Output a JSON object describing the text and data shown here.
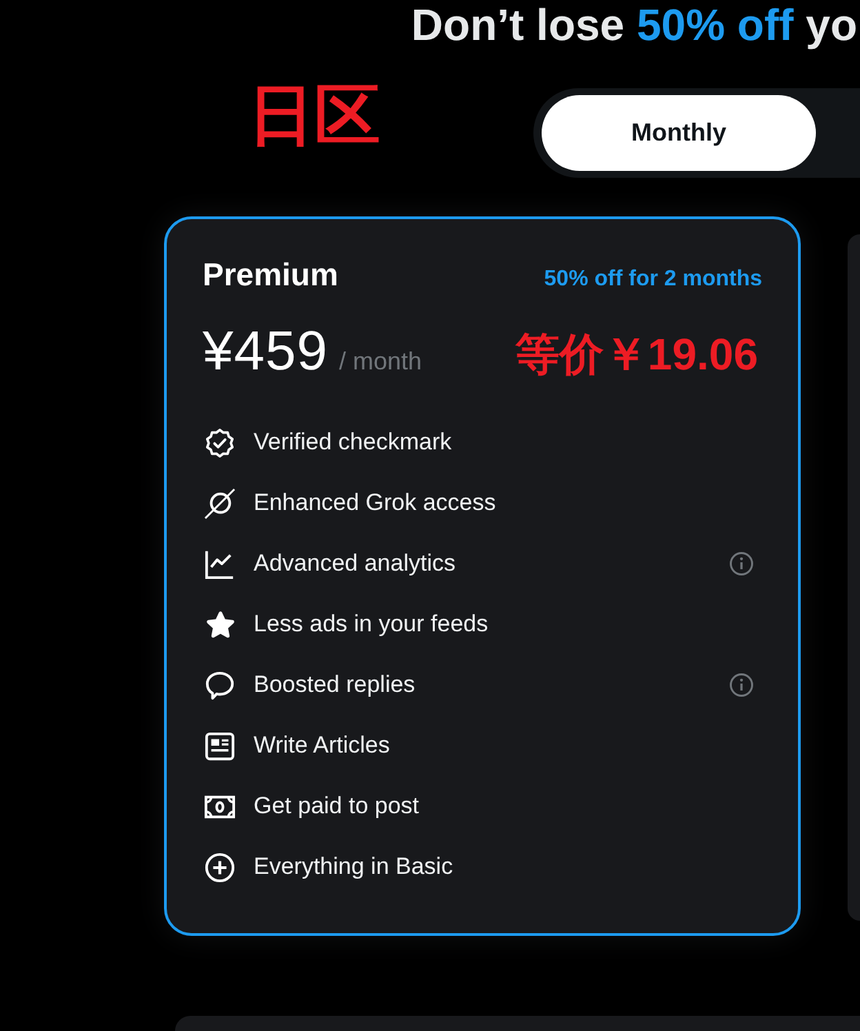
{
  "headline": [
    {
      "text": "Don’t lose ",
      "highlight": false
    },
    {
      "text": "50% off",
      "highlight": true
    },
    {
      "text": " yo",
      "highlight": false
    }
  ],
  "annotation": "日区",
  "billing_toggle": {
    "tabs": [
      {
        "label": "Monthly",
        "selected": true
      }
    ]
  },
  "plans": [
    {
      "kind": "full",
      "selected": true,
      "name": "Premium",
      "offer": "50% off for 2 months",
      "price": "¥459",
      "period": "/ month",
      "annotation": "等价￥19.06",
      "features": [
        {
          "label": "Verified checkmark",
          "info": false
        },
        {
          "label": "Enhanced Grok access",
          "info": false
        },
        {
          "label": "Advanced analytics",
          "info": true
        },
        {
          "label": "Less ads in your feeds",
          "info": false
        },
        {
          "label": "Boosted replies",
          "info": true
        },
        {
          "label": "Write Articles",
          "info": false
        },
        {
          "label": "Get paid to post",
          "info": false
        },
        {
          "label": "Everything in Basic",
          "info": false
        }
      ]
    }
  ]
}
